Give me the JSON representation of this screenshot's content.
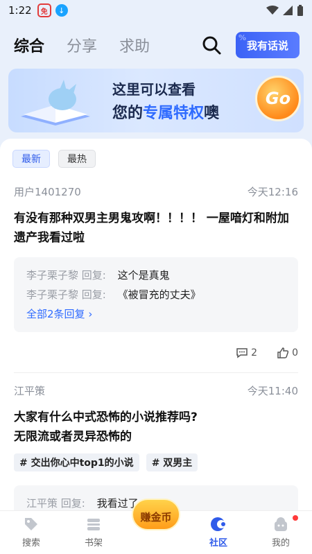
{
  "status_bar": {
    "time": "1:22",
    "app_badge": "免"
  },
  "top_tabs": [
    {
      "label": "综合",
      "active": true
    },
    {
      "label": "分享",
      "active": false
    },
    {
      "label": "求助",
      "active": false
    }
  ],
  "speak_button": "我有话说",
  "banner": {
    "line1": "这里可以查看",
    "line2_prefix": "您的",
    "line2_highlight": "专属特权",
    "line2_suffix": "噢",
    "go_label": "Go"
  },
  "filter_chips": [
    {
      "label": "最新",
      "active": true
    },
    {
      "label": "最热",
      "active": false
    }
  ],
  "posts": [
    {
      "author": "用户1401270",
      "time": "今天12:16",
      "title": "有没有那种双男主男鬼攻啊！！！！ 一屋喑灯和附加遗产我看过啦",
      "replies": [
        {
          "who": "李子栗子黎 回复:",
          "text": "这个是真鬼"
        },
        {
          "who": "李子栗子黎 回复:",
          "text": "《被冒充的丈夫》"
        }
      ],
      "more_replies": "全部2条回复",
      "comments": "2",
      "likes": "0"
    },
    {
      "author": "江平策",
      "time": "今天11:40",
      "title": "大家有什么中式恐怖的小说推荐吗?\n无限流或者灵异恐怖的",
      "tags": [
        "# 交出你心中top1的小说",
        "# 双男主"
      ],
      "replies": [
        {
          "who": "江平策 回复:",
          "text": "我看过了"
        }
      ]
    }
  ],
  "bottom_nav": [
    {
      "label": "搜索",
      "icon": "tag-icon",
      "active": false
    },
    {
      "label": "书架",
      "icon": "shelf-icon",
      "active": false
    },
    {
      "label": "赚金币",
      "icon": "coin-icon",
      "active": false
    },
    {
      "label": "社区",
      "icon": "community-icon",
      "active": true
    },
    {
      "label": "我的",
      "icon": "profile-icon",
      "active": false
    }
  ],
  "colors": {
    "accent": "#2f5bea",
    "highlight": "#2f6bff",
    "badge_dot": "#ff3a3a"
  }
}
